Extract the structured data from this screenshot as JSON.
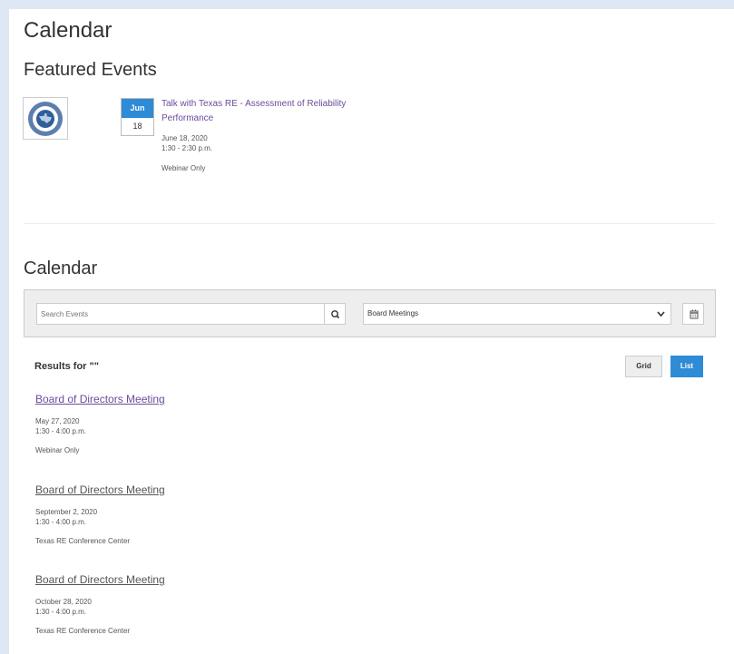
{
  "page": {
    "title": "Calendar",
    "featured_heading": "Featured Events"
  },
  "featured": {
    "logo_icon": "texas-re-10-years-logo-icon",
    "logo_text_top": "10 YEARS",
    "logo_text_bottom": "2010-2020",
    "month": "Jun",
    "day": "18",
    "title": "Talk with Texas RE - Assessment of Reliability Performance",
    "date": "June 18, 2020",
    "time": "1:30 - 2:30 p.m.",
    "location": "Webinar Only"
  },
  "calendar": {
    "heading": "Calendar",
    "search_placeholder": "Search Events",
    "search_icon": "search-icon",
    "category_selected": "Board Meetings",
    "calendar_icon": "calendar-icon",
    "results_label": "Results for \"\"",
    "grid_label": "Grid",
    "list_label": "List"
  },
  "events": [
    {
      "title": "Board of Directors Meeting",
      "date": "May 27, 2020",
      "time": "1:30 - 4:00 p.m.",
      "location": "Webinar Only",
      "visited": true
    },
    {
      "title": "Board of Directors Meeting",
      "date": "September 2, 2020",
      "time": "1:30 - 4:00 p.m.",
      "location": "Texas RE Conference Center",
      "visited": false
    },
    {
      "title": "Board of Directors Meeting",
      "date": "October 28, 2020",
      "time": "1:30 - 4:00 p.m.",
      "location": "Texas RE Conference Center",
      "visited": false
    }
  ],
  "colors": {
    "accent": "#2e8bd6",
    "link_visited": "#6b4c9a",
    "page_border": "#dfe6f4"
  }
}
